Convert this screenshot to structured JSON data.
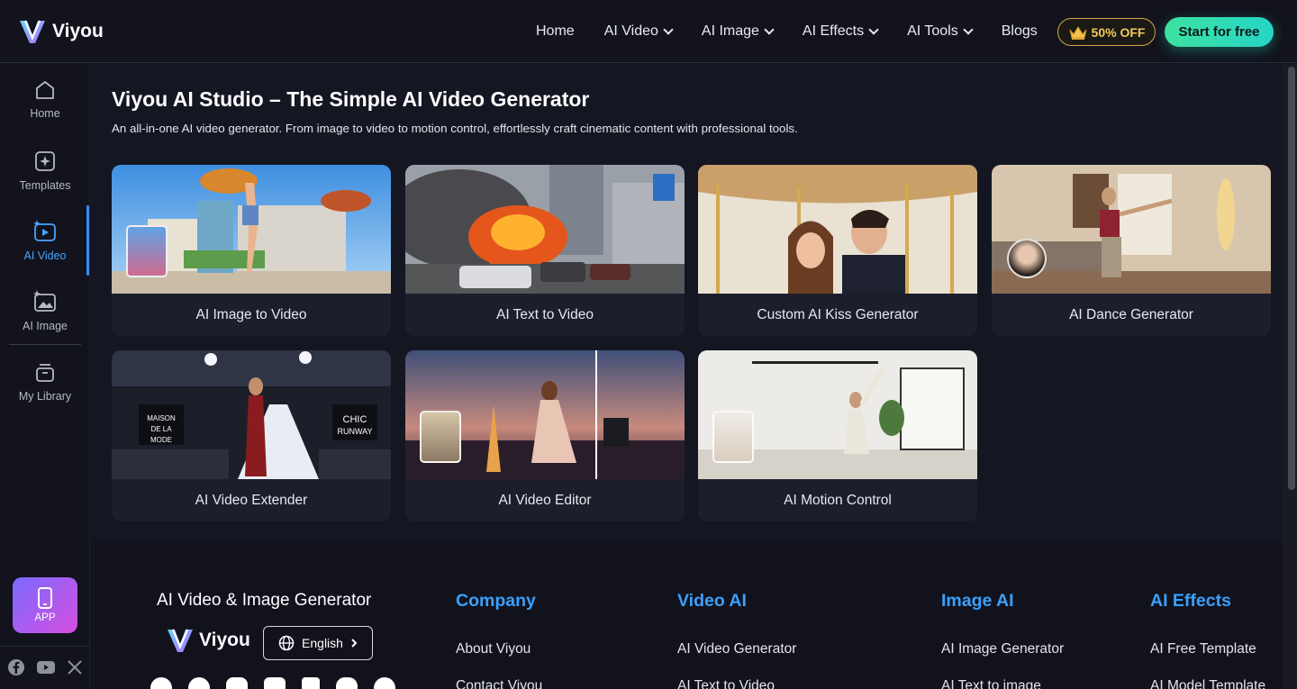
{
  "brand": {
    "name": "Viyou"
  },
  "nav": {
    "items": [
      {
        "label": "Home",
        "dropdown": false
      },
      {
        "label": "AI Video",
        "dropdown": true
      },
      {
        "label": "AI Image",
        "dropdown": true
      },
      {
        "label": "AI Effects",
        "dropdown": true
      },
      {
        "label": "AI Tools",
        "dropdown": true
      },
      {
        "label": "Blogs",
        "dropdown": false
      }
    ],
    "offer_label": "50% OFF",
    "cta_label": "Start for free"
  },
  "sidebar": {
    "items": [
      {
        "label": "Home",
        "icon": "home-icon"
      },
      {
        "label": "Templates",
        "icon": "templates-icon"
      },
      {
        "label": "AI Video",
        "icon": "ai-video-icon",
        "active": true
      },
      {
        "label": "AI Image",
        "icon": "ai-image-icon"
      },
      {
        "label": "My Library",
        "icon": "library-icon"
      }
    ],
    "app_label": "APP"
  },
  "main": {
    "title": "Viyou AI Studio – The Simple AI Video Generator",
    "subtitle": "An all-in-one AI video generator. From image to video to motion control, effortlessly craft cinematic content with professional tools.",
    "cards": [
      {
        "label": "AI Image to Video"
      },
      {
        "label": "AI Text to Video"
      },
      {
        "label": "Custom AI Kiss Generator"
      },
      {
        "label": "AI Dance Generator"
      },
      {
        "label": "AI Video Extender"
      },
      {
        "label": "AI Video Editor"
      },
      {
        "label": "AI Motion Control"
      }
    ]
  },
  "footer": {
    "tagline": "AI Video & Image Generator",
    "language": "English",
    "columns": [
      {
        "heading": "Company",
        "links": [
          "About Viyou",
          "Contact Viyou"
        ]
      },
      {
        "heading": "Video AI",
        "links": [
          "AI Video Generator",
          "AI Text to Video"
        ]
      },
      {
        "heading": "Image AI",
        "links": [
          "AI Image Generator",
          "AI Text to image"
        ]
      },
      {
        "heading": "AI Effects",
        "links": [
          "AI Free Template",
          "AI Model Template"
        ]
      }
    ]
  },
  "colors": {
    "accent": "#3aa0ff",
    "cta": "#2fdcae",
    "offer": "#f4c85a",
    "app": "#b15bf0"
  }
}
